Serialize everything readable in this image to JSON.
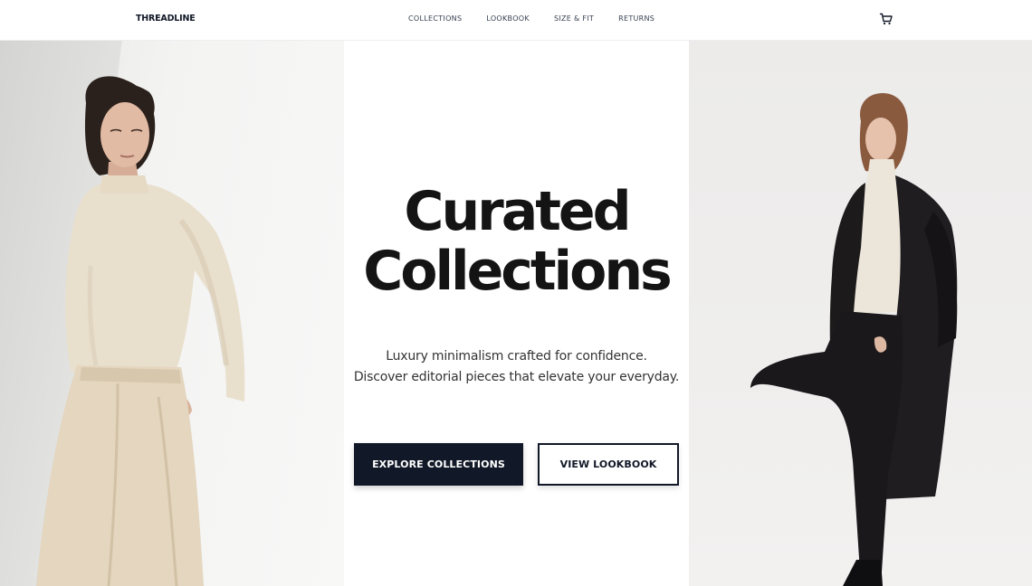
{
  "brand": {
    "name": "THREADLINE"
  },
  "nav": {
    "items": [
      {
        "label": "COLLECTIONS"
      },
      {
        "label": "LOOKBOOK"
      },
      {
        "label": "SIZE & FIT"
      },
      {
        "label": "RETURNS"
      }
    ],
    "cart_icon": "cart-icon"
  },
  "hero": {
    "title_line1": "Curated",
    "title_line2": "Collections",
    "subtitle_line1": "Luxury minimalism crafted for confidence.",
    "subtitle_line2": "Discover editorial pieces that elevate your everyday.",
    "primary_button": "EXPLORE COLLECTIONS",
    "secondary_button": "VIEW LOOKBOOK"
  },
  "colors": {
    "primary": "#111827",
    "background": "#ffffff",
    "cream_outfit": "#e8dcc8",
    "dark_outfit": "#1c1a1c"
  }
}
